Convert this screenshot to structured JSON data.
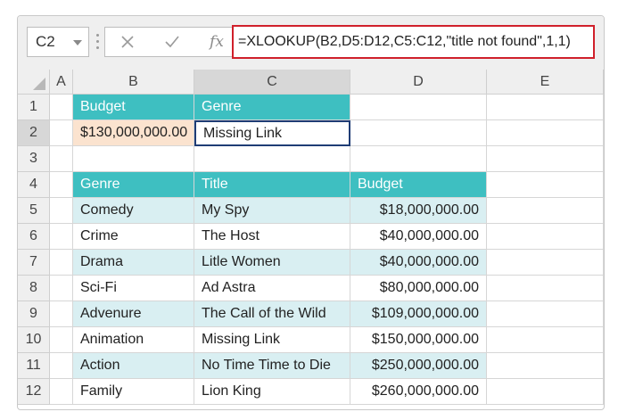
{
  "name_box": {
    "value": "C2"
  },
  "formula_bar": {
    "cancel_icon": "x-icon",
    "enter_icon": "check-icon",
    "fx_label": "fx",
    "formula": "=XLOOKUP(B2,D5:D12,C5:C12,\"title not found\",1,1)"
  },
  "columns": [
    "A",
    "B",
    "C",
    "D",
    "E"
  ],
  "rows": [
    "1",
    "2",
    "3",
    "4",
    "5",
    "6",
    "7",
    "8",
    "9",
    "10",
    "11",
    "12"
  ],
  "lookup": {
    "header_budget": "Budget",
    "header_genre": "Genre",
    "budget_value": "$130,000,000.00",
    "genre_result": "Missing Link"
  },
  "table": {
    "headers": [
      "Genre",
      "Title",
      "Budget"
    ],
    "rows": [
      [
        "Comedy",
        "My Spy",
        "$18,000,000.00"
      ],
      [
        "Crime",
        "The Host",
        "$40,000,000.00"
      ],
      [
        "Drama",
        "Litle Women",
        "$40,000,000.00"
      ],
      [
        "Sci-Fi",
        "Ad Astra",
        "$80,000,000.00"
      ],
      [
        "Advenure",
        "The Call of the Wild",
        "$109,000,000.00"
      ],
      [
        "Animation",
        "Missing Link",
        "$150,000,000.00"
      ],
      [
        "Action",
        "No Time Time  to Die",
        "$250,000,000.00"
      ],
      [
        "Family",
        "Lion King",
        "$260,000,000.00"
      ]
    ]
  },
  "colors": {
    "header_teal": "#3ebfc1",
    "band_light": "#d9eff2",
    "input_peach": "#fbe3cf",
    "formula_border": "#d0202b",
    "active_border": "#1f3d75"
  }
}
